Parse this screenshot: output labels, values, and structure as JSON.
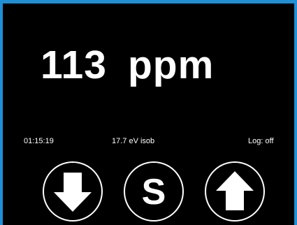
{
  "display": {
    "concentration_value": "113",
    "concentration_unit": "ppm"
  },
  "status_bar": {
    "clock": "01:15:19",
    "lamp": "17.7 eV isob",
    "log": "Log: off"
  },
  "controls": {
    "down_button": {
      "icon": "arrow-down-icon"
    },
    "span_button": {
      "icon": "letter-s-icon",
      "glyph": "S"
    },
    "up_button": {
      "icon": "arrow-up-icon"
    }
  },
  "colors": {
    "frame": "#1f8fd6",
    "background": "#000000",
    "foreground": "#ffffff"
  }
}
